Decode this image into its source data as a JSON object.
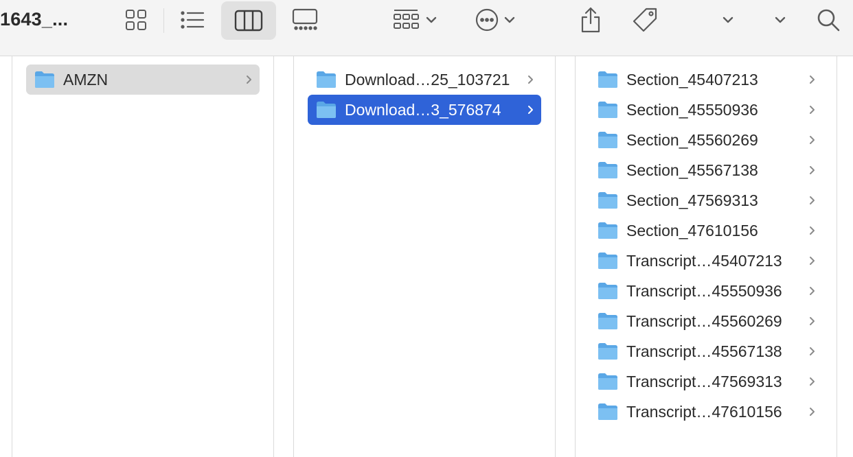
{
  "window": {
    "title": "1643_..."
  },
  "toolbar": {
    "icons": [
      "icon-view-icon",
      "list-view-icon",
      "column-view-icon",
      "gallery-view-icon",
      "group-icon",
      "chevron-down-icon",
      "more-icon",
      "chevron-down-icon",
      "share-icon",
      "tag-icon",
      "chevron-down-icon",
      "chevron-down-icon",
      "search-icon"
    ],
    "active_view": "column"
  },
  "columns": [
    {
      "items": [
        {
          "label": "AMZN",
          "selected": "inactive"
        }
      ]
    },
    {
      "items": [
        {
          "label": "Download…25_103721",
          "selected": "none"
        },
        {
          "label": "Download…3_576874",
          "selected": "active"
        }
      ]
    },
    {
      "items": [
        {
          "label": "Section_45407213"
        },
        {
          "label": "Section_45550936"
        },
        {
          "label": "Section_45560269"
        },
        {
          "label": "Section_45567138"
        },
        {
          "label": "Section_47569313"
        },
        {
          "label": "Section_47610156"
        },
        {
          "label": "Transcript…45407213"
        },
        {
          "label": "Transcript…45550936"
        },
        {
          "label": "Transcript…45560269"
        },
        {
          "label": "Transcript…45567138"
        },
        {
          "label": "Transcript…47569313"
        },
        {
          "label": "Transcript…47610156"
        }
      ]
    }
  ],
  "colors": {
    "selection_active": "#2f63d8",
    "selection_inactive": "#dcdcdc",
    "folder": "#6fb6ee",
    "toolbar_icon": "#5a5a5a"
  }
}
